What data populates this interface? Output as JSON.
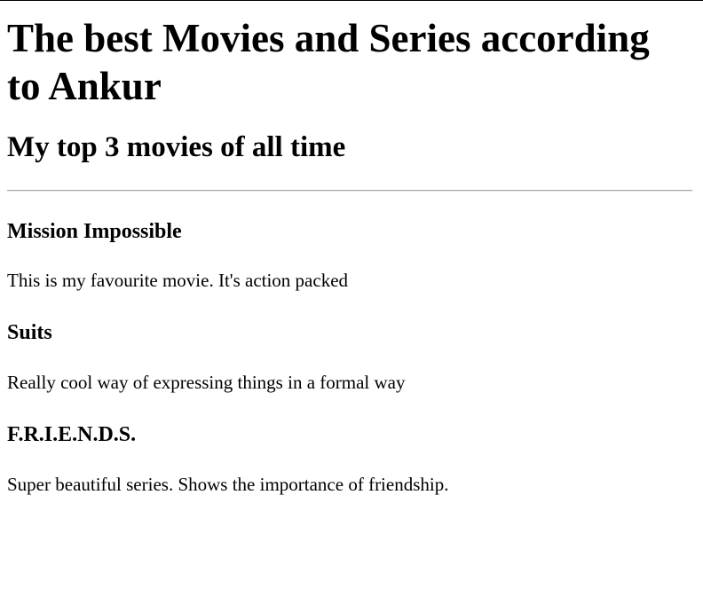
{
  "page": {
    "title": "The best Movies and Series according to Ankur",
    "subtitle": "My top 3 movies of all time"
  },
  "entries": [
    {
      "heading": "Mission Impossible",
      "description": "This is my favourite movie. It's action packed"
    },
    {
      "heading": "Suits",
      "description": "Really cool way of expressing things in a formal way"
    },
    {
      "heading": "F.R.I.E.N.D.S.",
      "description": "Super beautiful series. Shows the importance of friendship."
    }
  ]
}
